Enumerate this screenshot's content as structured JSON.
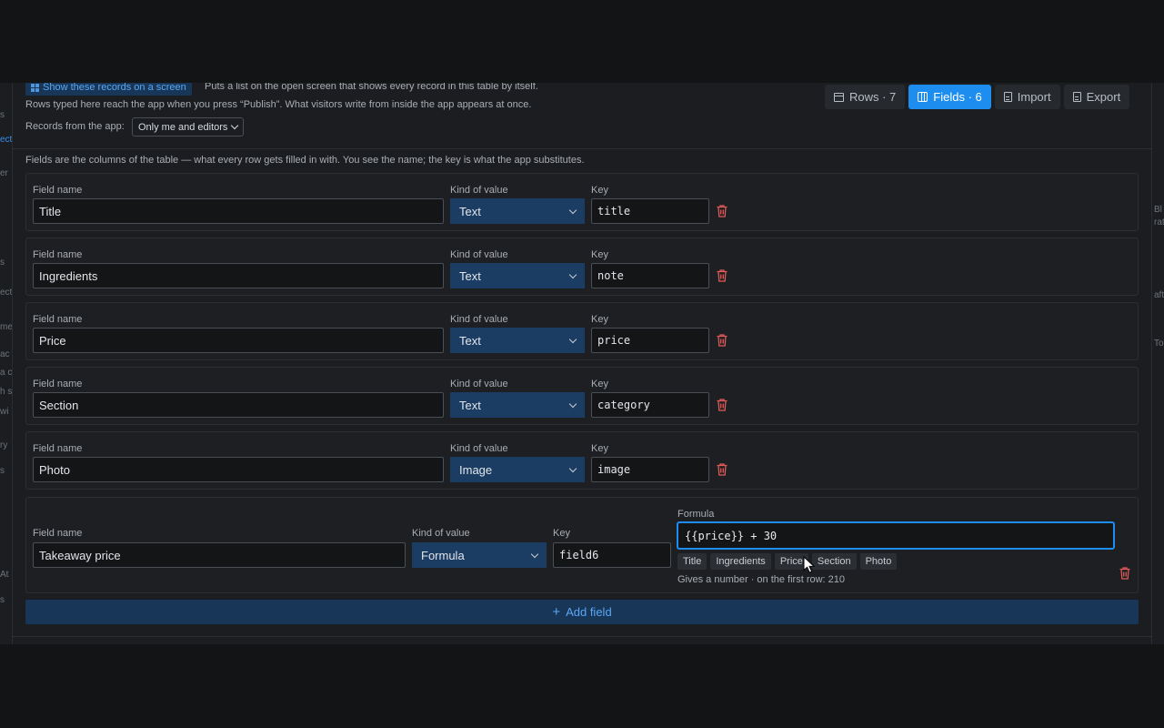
{
  "header": {
    "show_records_label": "Show these records on a screen",
    "show_records_desc": "Puts a list on the open screen that shows every record in this table by itself.",
    "publish_note": "Rows typed here reach the app when you press “Publish”. What visitors write from inside the app appears at once.",
    "records_label": "Records from the app:",
    "records_value": "Only me and editors"
  },
  "tabs": [
    {
      "label": "Rows · 7",
      "icon": "table-icon",
      "active": false
    },
    {
      "label": "Fields · 6",
      "icon": "columns-icon",
      "active": true
    },
    {
      "label": "Import",
      "icon": "file-import-icon",
      "active": false
    },
    {
      "label": "Export",
      "icon": "file-export-icon",
      "active": false
    }
  ],
  "fields_intro": "Fields are the columns of the table — what every row gets filled in with. You see the name; the key is what the app substitutes.",
  "labels": {
    "field_name": "Field name",
    "kind": "Kind of value",
    "key": "Key",
    "formula": "Formula"
  },
  "fields": [
    {
      "name": "Title",
      "kind": "Text",
      "key": "title"
    },
    {
      "name": "Ingredients",
      "kind": "Text",
      "key": "note"
    },
    {
      "name": "Price",
      "kind": "Text",
      "key": "price"
    },
    {
      "name": "Section",
      "kind": "Text",
      "key": "category"
    },
    {
      "name": "Photo",
      "kind": "Image",
      "key": "image"
    }
  ],
  "formula_field": {
    "name": "Takeaway price",
    "kind": "Formula",
    "key": "field6",
    "formula": "{{price}} + 30",
    "chips": [
      "Title",
      "Ingredients",
      "Price",
      "Section",
      "Photo"
    ],
    "hint": "Gives a number · on the first row: 210"
  },
  "add_field_label": "Add field",
  "gutter_left": [
    "s",
    "ect",
    "er",
    "s",
    "ect",
    "me",
    "ac",
    "a c",
    "h s",
    "wi",
    "ry",
    "s",
    "At",
    "s"
  ],
  "gutter_right": [
    "Bl",
    "rat",
    "aft",
    "To"
  ],
  "colors": {
    "accent": "#1d8ef0",
    "select_bg": "#1b3c63",
    "danger": "#e05a5a",
    "panel": "#1b1d20"
  }
}
